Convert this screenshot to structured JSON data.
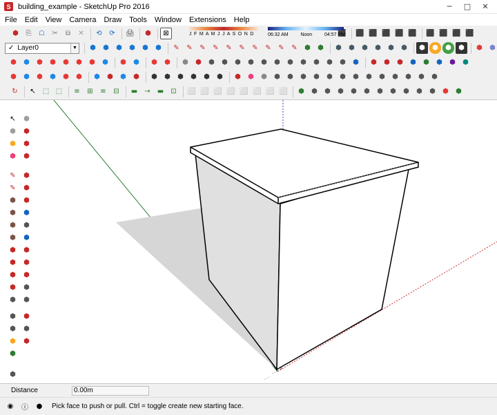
{
  "window": {
    "title": "building_example - SketchUp Pro 2016",
    "min": "─",
    "max": "□",
    "close": "✕"
  },
  "menu": [
    "File",
    "Edit",
    "View",
    "Camera",
    "Draw",
    "Tools",
    "Window",
    "Extensions",
    "Help"
  ],
  "layer": {
    "name": "Layer0",
    "check": "✓"
  },
  "shadow": {
    "months": "J F M A M J J A S O N D",
    "time_start": "06:32 AM",
    "time_noon": "Noon",
    "time_end": "04:57 PM"
  },
  "colors": {
    "red_axis": "#d32f2f",
    "green_axis": "#2e7d32",
    "blue_axis": "#3949ab",
    "shadow": "#d6d6d6",
    "side_face": "#e0e0e0"
  },
  "icons": {
    "row1": [
      "⬢",
      "⎘",
      "☖",
      "✂",
      "⧉",
      "✕",
      "⟲",
      "⟳",
      "🖨",
      "⬢",
      "⊠",
      "⬛",
      "⬛",
      "⬛",
      "⬛",
      "⬛",
      "⬛",
      "⬛",
      "⬛",
      "⬛",
      "⬛",
      "⬛",
      "⬛"
    ],
    "row2": [
      "⬢",
      "⬢",
      "⬢",
      "⬢",
      "⬢",
      "⬢",
      "✎",
      "✎",
      "✎",
      "✎",
      "✎",
      "✎",
      "✎",
      "✎",
      "✎",
      "✎",
      "⬢",
      "⬢",
      "⬢",
      "⬢",
      "⬢",
      "⬢",
      "⬢",
      "⬢",
      "⬢",
      "⬢",
      "⬢",
      "⬢",
      "⬢"
    ],
    "row3": [
      "⬢",
      "⬢",
      "⬢",
      "⬢",
      "⬢",
      "⬢",
      "⬢",
      "⬢",
      "⬢",
      "⬢",
      "⬢",
      "⬢",
      "⬢",
      "⬢",
      "⬢",
      "⬢",
      "⬢",
      "⬢",
      "⬢",
      "⬢",
      "⬢",
      "⬢",
      "⬢",
      "⬢",
      "⬢",
      "⬢",
      "⬢",
      "⬢",
      "⬢",
      "⬢",
      "⬢",
      "⬢",
      "⬢",
      "⬢",
      "⬢",
      "⬢",
      "⬢"
    ],
    "row4": [
      "⬢",
      "⬢",
      "⬢",
      "⬢",
      "⬢",
      "⬢",
      "⬢",
      "⬢",
      "⬢",
      "⬢",
      "⬢",
      "⬢",
      "⬢",
      "⬢",
      "⬢",
      "⬢",
      "⬢",
      "⬢",
      "⬢",
      "⬢",
      "⬢",
      "⬢",
      "⬢",
      "⬢",
      "⬢",
      "⬢",
      "⬢",
      "⬢",
      "⬢",
      "⬢",
      "⬢",
      "⬢",
      "⬢",
      "⬢"
    ],
    "row5": [
      "↻",
      "↖",
      "⬚",
      "⬚",
      "≡",
      "⊞",
      "≡",
      "⊟",
      "▬",
      "→",
      "▬",
      "⊡",
      "⬜",
      "⬜",
      "⬜",
      "⬜",
      "⬜",
      "⬜",
      "⬜",
      "⬜",
      "⬢",
      "⬢",
      "⬢",
      "⬢",
      "⬢",
      "⬢",
      "⬢",
      "⬢",
      "⬢",
      "⬢",
      "⬢",
      "⬢",
      "⬢",
      "⬢",
      "⬢",
      "⬢",
      "⬢"
    ]
  },
  "vcb": {
    "label": "Distance",
    "value": "0.00m"
  },
  "status": {
    "message": "Pick face to push or pull.  Ctrl = toggle create new starting face.",
    "icon1": "◉",
    "icon2": "ⓘ",
    "icon3": "●"
  }
}
